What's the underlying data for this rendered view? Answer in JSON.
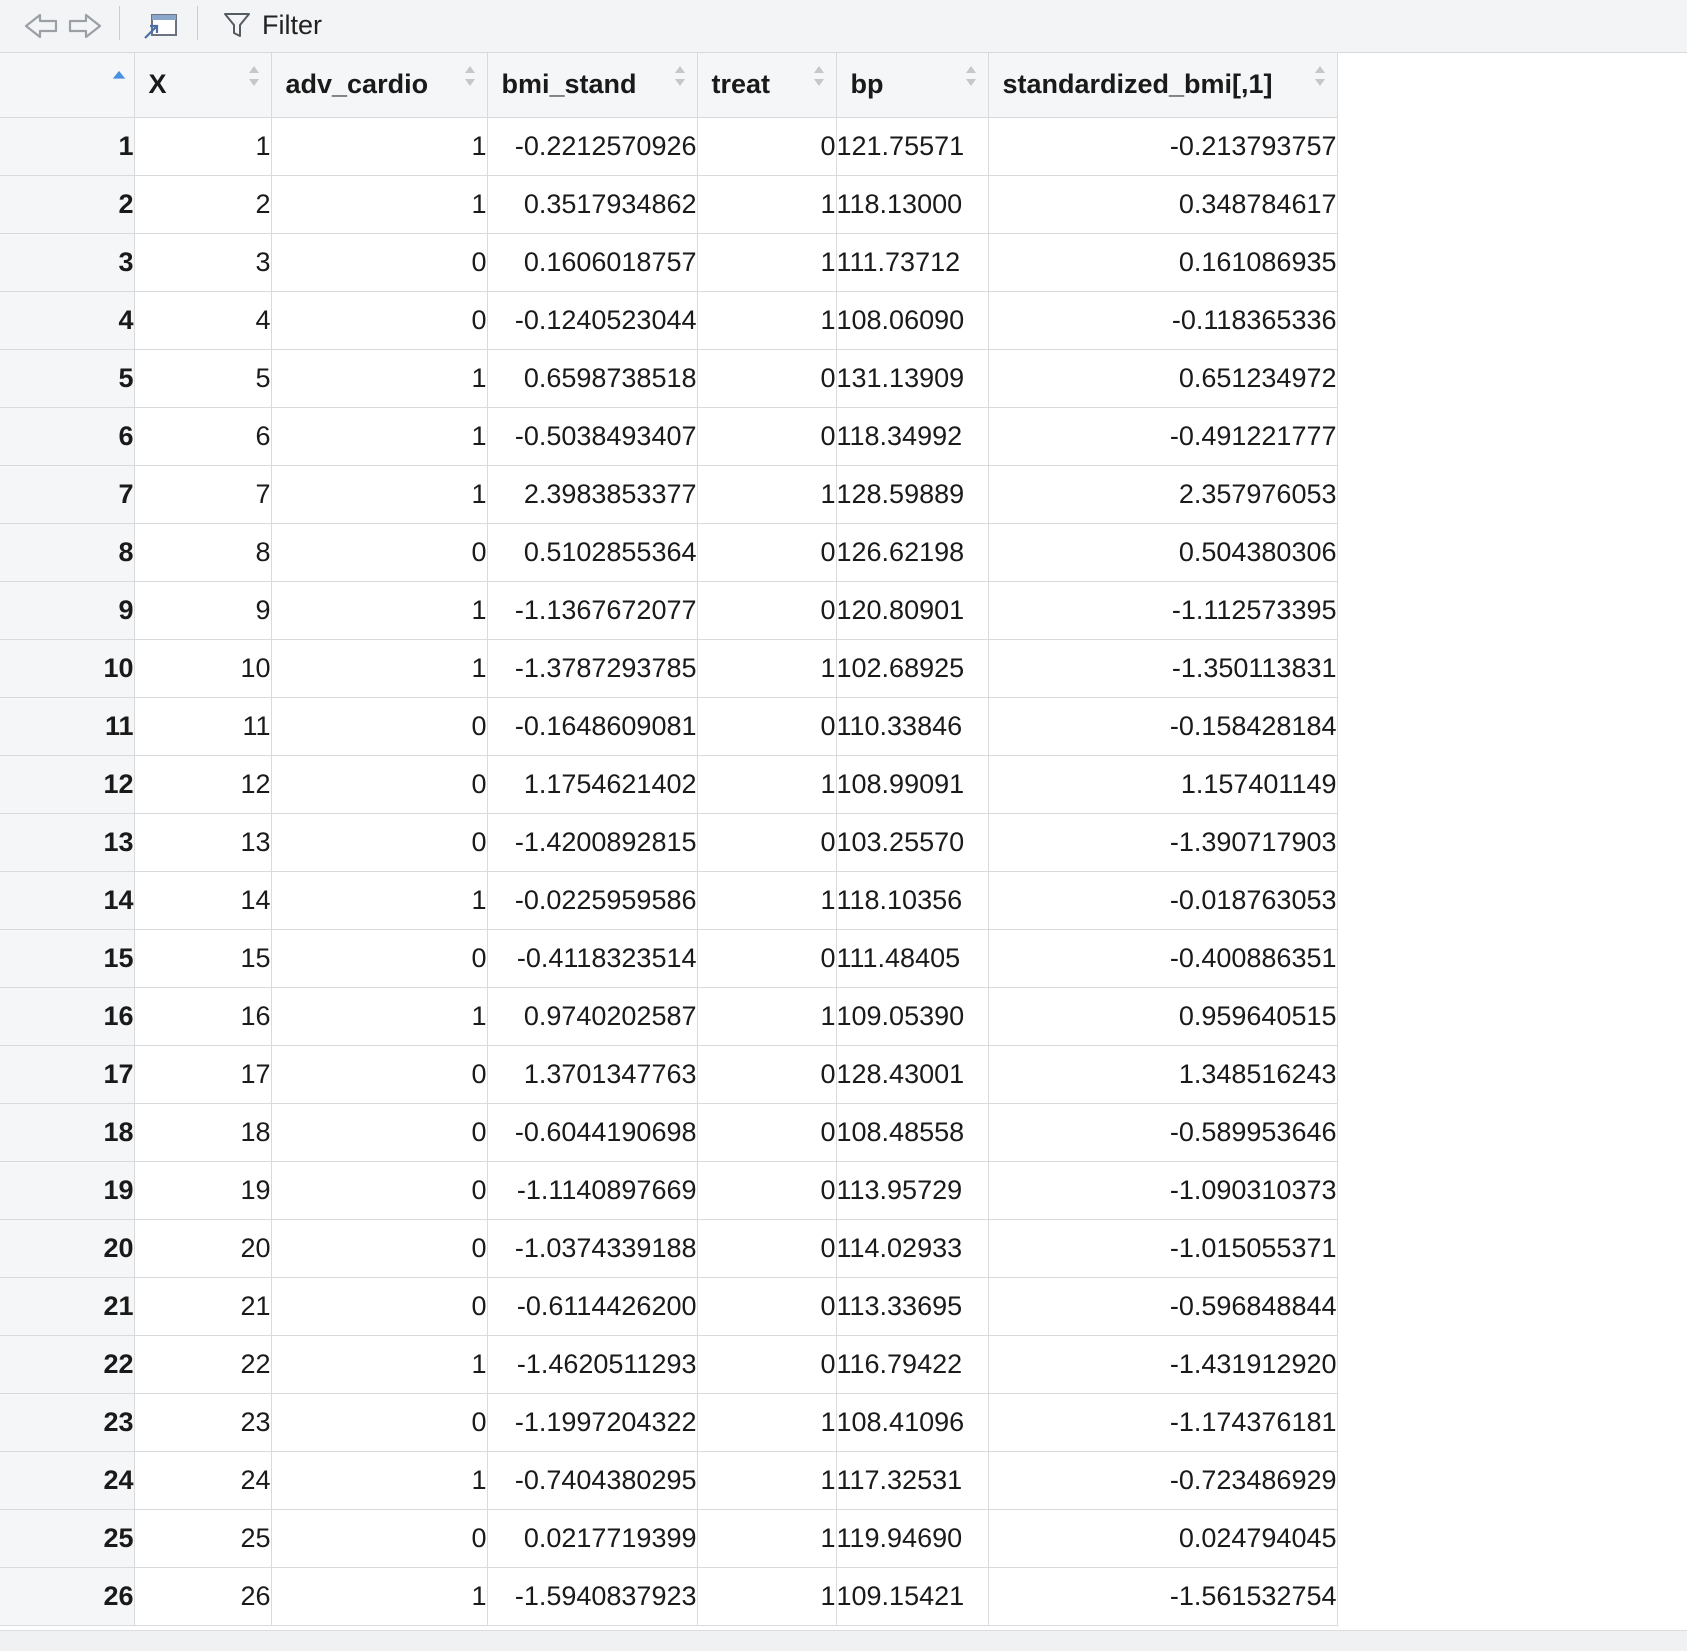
{
  "toolbar": {
    "back_icon": "arrow-left-icon",
    "forward_icon": "arrow-right-icon",
    "popout_icon": "open-in-window-icon",
    "filter_icon": "funnel-icon",
    "filter_label": "Filter"
  },
  "table": {
    "columns": [
      "X",
      "adv_cardio",
      "bmi_stand",
      "treat",
      "bp",
      "standardized_bmi[,1]"
    ],
    "rows": [
      {
        "rowname": "1",
        "cells": [
          "1",
          "1",
          "-0.2212570926",
          "0",
          "121.75571",
          "-0.213793757"
        ]
      },
      {
        "rowname": "2",
        "cells": [
          "2",
          "1",
          "0.3517934862",
          "1",
          "118.13000",
          "0.348784617"
        ]
      },
      {
        "rowname": "3",
        "cells": [
          "3",
          "0",
          "0.1606018757",
          "1",
          "111.73712",
          "0.161086935"
        ]
      },
      {
        "rowname": "4",
        "cells": [
          "4",
          "0",
          "-0.1240523044",
          "1",
          "108.06090",
          "-0.118365336"
        ]
      },
      {
        "rowname": "5",
        "cells": [
          "5",
          "1",
          "0.6598738518",
          "0",
          "131.13909",
          "0.651234972"
        ]
      },
      {
        "rowname": "6",
        "cells": [
          "6",
          "1",
          "-0.5038493407",
          "0",
          "118.34992",
          "-0.491221777"
        ]
      },
      {
        "rowname": "7",
        "cells": [
          "7",
          "1",
          "2.3983853377",
          "1",
          "128.59889",
          "2.357976053"
        ]
      },
      {
        "rowname": "8",
        "cells": [
          "8",
          "0",
          "0.5102855364",
          "0",
          "126.62198",
          "0.504380306"
        ]
      },
      {
        "rowname": "9",
        "cells": [
          "9",
          "1",
          "-1.1367672077",
          "0",
          "120.80901",
          "-1.112573395"
        ]
      },
      {
        "rowname": "10",
        "cells": [
          "10",
          "1",
          "-1.3787293785",
          "1",
          "102.68925",
          "-1.350113831"
        ]
      },
      {
        "rowname": "11",
        "cells": [
          "11",
          "0",
          "-0.1648609081",
          "0",
          "110.33846",
          "-0.158428184"
        ]
      },
      {
        "rowname": "12",
        "cells": [
          "12",
          "0",
          "1.1754621402",
          "1",
          "108.99091",
          "1.157401149"
        ]
      },
      {
        "rowname": "13",
        "cells": [
          "13",
          "0",
          "-1.4200892815",
          "0",
          "103.25570",
          "-1.390717903"
        ]
      },
      {
        "rowname": "14",
        "cells": [
          "14",
          "1",
          "-0.0225959586",
          "1",
          "118.10356",
          "-0.018763053"
        ]
      },
      {
        "rowname": "15",
        "cells": [
          "15",
          "0",
          "-0.4118323514",
          "0",
          "111.48405",
          "-0.400886351"
        ]
      },
      {
        "rowname": "16",
        "cells": [
          "16",
          "1",
          "0.9740202587",
          "1",
          "109.05390",
          "0.959640515"
        ]
      },
      {
        "rowname": "17",
        "cells": [
          "17",
          "0",
          "1.3701347763",
          "0",
          "128.43001",
          "1.348516243"
        ]
      },
      {
        "rowname": "18",
        "cells": [
          "18",
          "0",
          "-0.6044190698",
          "0",
          "108.48558",
          "-0.589953646"
        ]
      },
      {
        "rowname": "19",
        "cells": [
          "19",
          "0",
          "-1.1140897669",
          "0",
          "113.95729",
          "-1.090310373"
        ]
      },
      {
        "rowname": "20",
        "cells": [
          "20",
          "0",
          "-1.0374339188",
          "0",
          "114.02933",
          "-1.015055371"
        ]
      },
      {
        "rowname": "21",
        "cells": [
          "21",
          "0",
          "-0.6114426200",
          "0",
          "113.33695",
          "-0.596848844"
        ]
      },
      {
        "rowname": "22",
        "cells": [
          "22",
          "1",
          "-1.4620511293",
          "0",
          "116.79422",
          "-1.431912920"
        ]
      },
      {
        "rowname": "23",
        "cells": [
          "23",
          "0",
          "-1.1997204322",
          "1",
          "108.41096",
          "-1.174376181"
        ]
      },
      {
        "rowname": "24",
        "cells": [
          "24",
          "1",
          "-0.7404380295",
          "1",
          "117.32531",
          "-0.723486929"
        ]
      },
      {
        "rowname": "25",
        "cells": [
          "25",
          "0",
          "0.0217719399",
          "1",
          "119.94690",
          "0.024794045"
        ]
      },
      {
        "rowname": "26",
        "cells": [
          "26",
          "1",
          "-1.5940837923",
          "1",
          "109.15421",
          "-1.561532754"
        ]
      }
    ]
  }
}
